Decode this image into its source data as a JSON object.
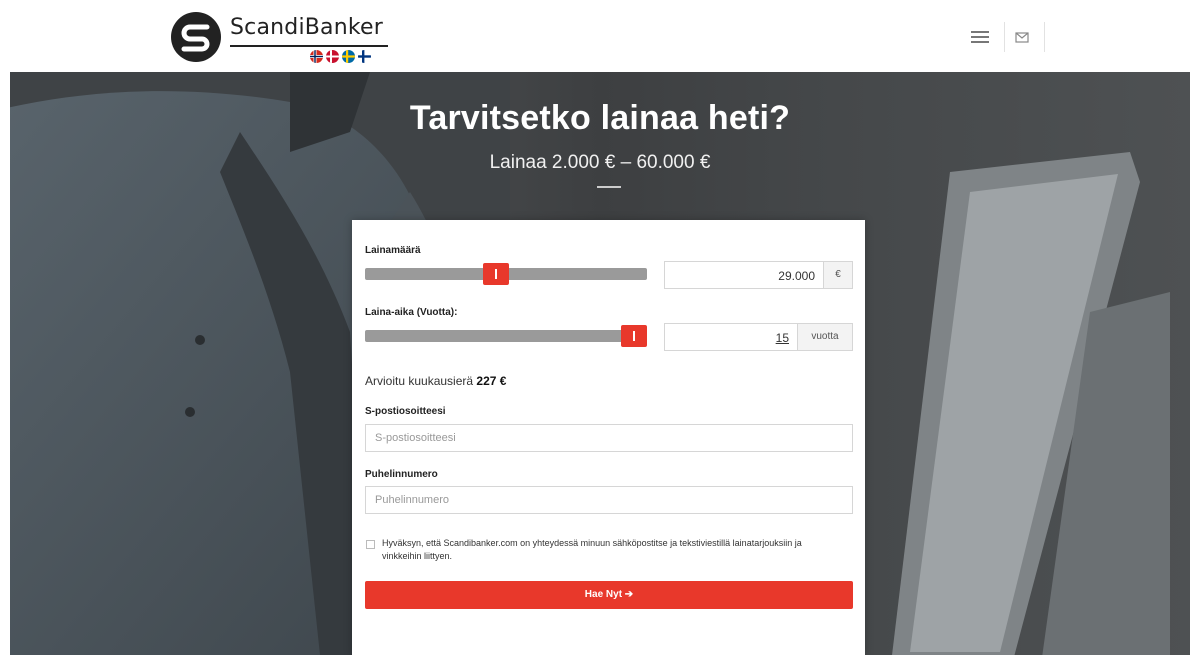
{
  "header": {
    "logo_text": "ScandiBanker",
    "flags": [
      "norway-flag",
      "denmark-flag",
      "sweden-flag",
      "finland-flag"
    ],
    "menu_icon": "hamburger-menu-icon",
    "mail_icon": "envelope-icon"
  },
  "hero": {
    "title": "Tarvitsetko lainaa heti?",
    "subtitle": "Lainaa 2.000 € – 60.000 €"
  },
  "form": {
    "amount": {
      "label": "Lainamäärä",
      "value": "29.000",
      "unit": "€",
      "slider_fraction": 0.46
    },
    "term": {
      "label": "Laina-aika (Vuotta):",
      "value": "15",
      "unit": "vuotta",
      "slider_fraction": 1.0
    },
    "estimate": {
      "prefix": "Arvioitu kuukausierä",
      "value": "227 €"
    },
    "email": {
      "label": "S-postiosoitteesi",
      "placeholder": "S-postiosoitteesi"
    },
    "phone": {
      "label": "Puhelinnumero",
      "placeholder": "Puhelinnumero"
    },
    "consent": "Hyväksyn, että Scandibanker.com on yhteydessä minuun sähköpostitse ja tekstiviestillä lainatarjouksiin ja vinkkeihin liittyen.",
    "submit_label": "Hae Nyt ➔"
  },
  "colors": {
    "accent": "#e8382b",
    "slider_track": "#9a9a9a",
    "hero_bg": "#45484a"
  }
}
